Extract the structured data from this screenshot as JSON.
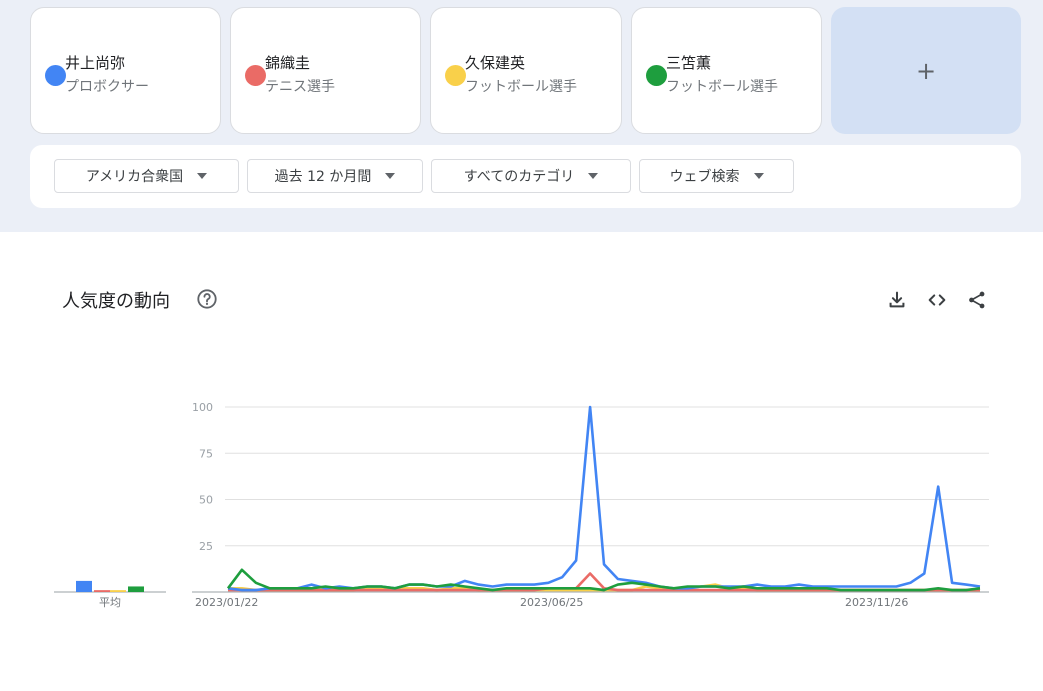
{
  "terms": [
    {
      "name": "井上尚弥",
      "type": "プロボクサー",
      "color": "#4285f4"
    },
    {
      "name": "錦織圭",
      "type": "テニス選手",
      "color": "#ea6b66"
    },
    {
      "name": "久保建英",
      "type": "フットボール選手",
      "color": "#f9d04a"
    },
    {
      "name": "三笘薫",
      "type": "フットボール選手",
      "color": "#1e9e3e"
    }
  ],
  "add_term": {
    "label": "+"
  },
  "filters": {
    "region": "アメリカ合衆国",
    "period": "過去 12 か月間",
    "category": "すべてのカテゴリ",
    "search_type": "ウェブ検索"
  },
  "chart": {
    "title": "人気度の動向",
    "average_label": "平均",
    "icons": [
      "help-icon",
      "download-icon",
      "embed-code-icon",
      "share-icon"
    ]
  },
  "chart_data": {
    "type": "line",
    "x_tick_labels": [
      "2023/01/22",
      "2023/06/25",
      "2023/11/26"
    ],
    "yticks": [
      25,
      50,
      75,
      100
    ],
    "ylim": [
      0,
      100
    ],
    "grid": true,
    "averages": [
      {
        "name": "井上尚弥",
        "value": 6
      },
      {
        "name": "錦織圭",
        "value": 1
      },
      {
        "name": "久保建英",
        "value": 1
      },
      {
        "name": "三笘薫",
        "value": 3
      }
    ],
    "series": [
      {
        "name": "井上尚弥",
        "color": "#4285f4",
        "values": [
          2,
          1,
          1,
          2,
          2,
          2,
          4,
          2,
          3,
          2,
          3,
          3,
          2,
          4,
          4,
          3,
          3,
          6,
          4,
          3,
          4,
          4,
          4,
          5,
          8,
          17,
          100,
          15,
          7,
          6,
          5,
          3,
          2,
          2,
          3,
          3,
          3,
          3,
          4,
          3,
          3,
          4,
          3,
          3,
          3,
          3,
          3,
          3,
          3,
          5,
          10,
          57,
          5,
          4,
          3
        ]
      },
      {
        "name": "錦織圭",
        "color": "#ea6b66",
        "values": [
          1,
          1,
          1,
          1,
          1,
          1,
          1,
          1,
          1,
          1,
          1,
          1,
          1,
          1,
          1,
          1,
          1,
          1,
          1,
          1,
          1,
          1,
          1,
          2,
          2,
          2,
          10,
          2,
          1,
          1,
          1,
          1,
          1,
          1,
          1,
          1,
          1,
          1,
          1,
          1,
          1,
          1,
          1,
          1,
          1,
          1,
          1,
          1,
          1,
          1,
          1,
          1,
          1,
          1,
          1
        ]
      },
      {
        "name": "久保建英",
        "color": "#f9d04a",
        "values": [
          2,
          2,
          1,
          1,
          1,
          1,
          1,
          1,
          1,
          1,
          2,
          2,
          2,
          2,
          2,
          1,
          2,
          2,
          1,
          1,
          1,
          1,
          1,
          1,
          1,
          1,
          1,
          1,
          1,
          1,
          3,
          2,
          2,
          2,
          3,
          4,
          2,
          2,
          1,
          1,
          1,
          1,
          1,
          1,
          1,
          1,
          1,
          1,
          1,
          1,
          1,
          1,
          1,
          1,
          1
        ]
      },
      {
        "name": "三笘薫",
        "color": "#1e9e3e",
        "values": [
          2,
          12,
          5,
          2,
          2,
          2,
          2,
          3,
          2,
          2,
          3,
          3,
          2,
          4,
          4,
          3,
          4,
          3,
          2,
          1,
          2,
          2,
          2,
          2,
          2,
          2,
          2,
          1,
          4,
          5,
          4,
          3,
          2,
          3,
          3,
          3,
          2,
          3,
          2,
          2,
          2,
          2,
          2,
          2,
          1,
          1,
          1,
          1,
          1,
          1,
          1,
          2,
          1,
          1,
          2
        ]
      }
    ]
  }
}
